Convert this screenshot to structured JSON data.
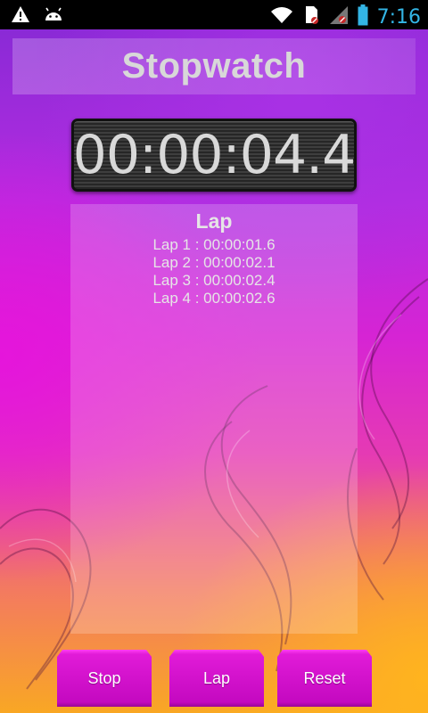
{
  "status_bar": {
    "left_icons": [
      "warning-icon",
      "android-icon"
    ],
    "right_icons": [
      "wifi-icon",
      "sd-card-icon",
      "signal-icon",
      "battery-icon"
    ],
    "time": "7:16",
    "time_color": "#33b5e5"
  },
  "app": {
    "title": "Stopwatch",
    "timer": "00:00:04.4",
    "lap_header": "Lap",
    "laps": [
      "Lap 1 : 00:00:01.6",
      "Lap 2 : 00:00:02.1",
      "Lap 3 : 00:00:02.4",
      "Lap 4 : 00:00:02.6"
    ],
    "buttons": {
      "stop": "Stop",
      "lap": "Lap",
      "reset": "Reset"
    }
  },
  "colors": {
    "button": "#d612d2",
    "background_top": "#8a2ad6",
    "background_bottom": "#f9a724",
    "text_light": "#e6e6e6"
  }
}
